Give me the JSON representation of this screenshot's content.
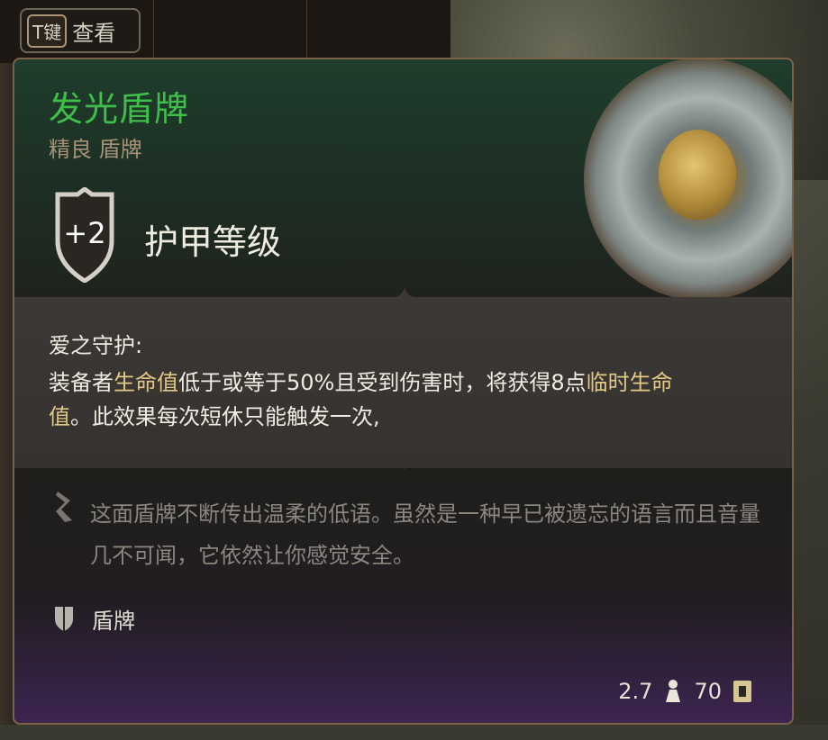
{
  "view_key": {
    "key": "T键",
    "label": "查看"
  },
  "item": {
    "name": "发光盾牌",
    "subtitle": "精良 盾牌",
    "name_color": "#3fbf49"
  },
  "armor_class": {
    "value": "+2",
    "label": "护甲等级"
  },
  "effect": {
    "title": "爱之守护:",
    "text_parts": [
      "装备者",
      "生命值",
      "低于或等于50%且受到伤害时，将获得8点",
      "临时生命值",
      "。此效果每次短休只能触发一次,"
    ]
  },
  "lore": {
    "icon": "lore-quill-icon",
    "text": "这面盾牌不断传出温柔的低语。虽然是一种早已被遗忘的语言而且音量几不可闻，它依然让你感觉安全。"
  },
  "item_type": {
    "icon": "shield-type-icon",
    "label": "盾牌"
  },
  "footer": {
    "weight": "2.7",
    "weight_icon": "weight-icon",
    "value": "70",
    "value_icon": "gold-icon"
  },
  "colors": {
    "highlight": "#e2c886",
    "border": "#7c6148",
    "rarity_green": "#3fbf49"
  }
}
